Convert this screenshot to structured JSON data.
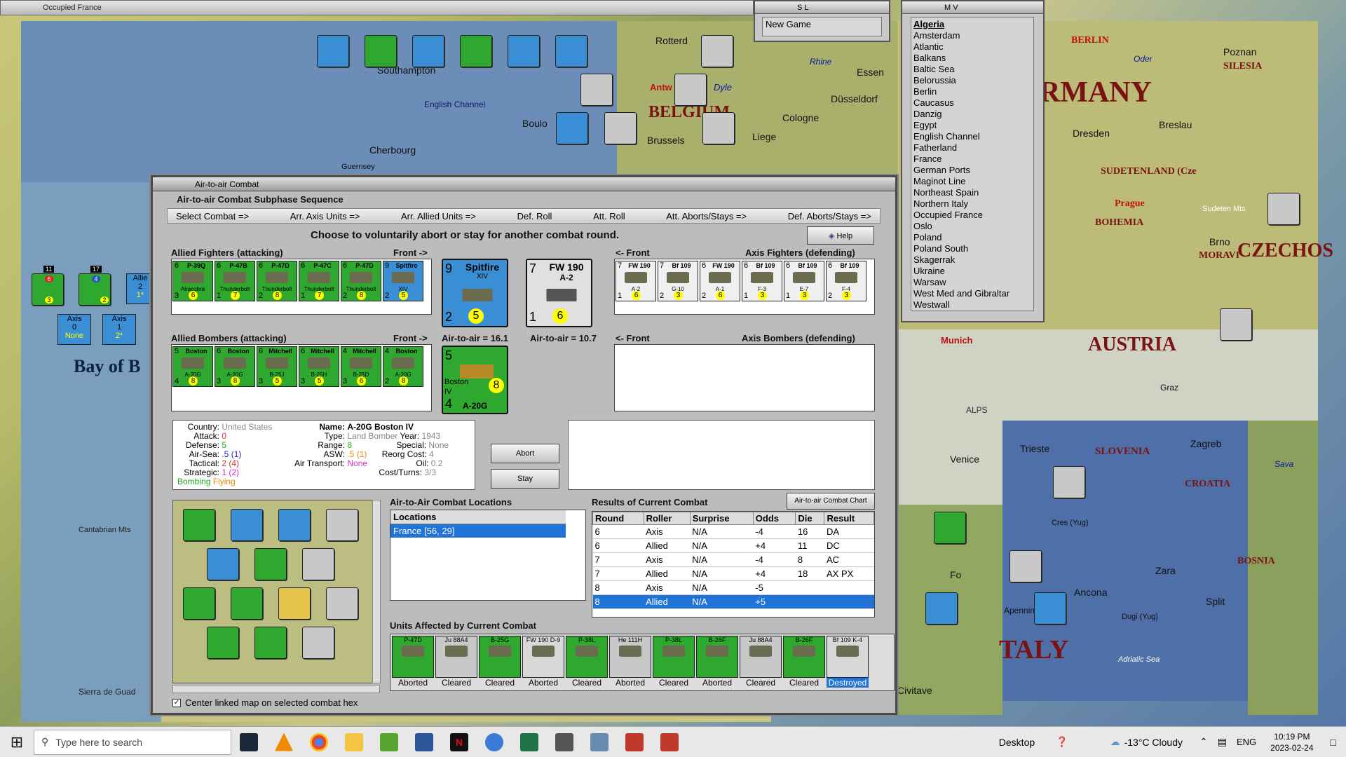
{
  "window": {
    "title": "Occupied France"
  },
  "map": {
    "labels": [
      "BELGIUM",
      "RMANY",
      "AUSTRIA",
      "TALY",
      "CZECHOS",
      "Bay of B",
      "English Channel",
      "SUDETENLAND (Cze",
      "BOHEMIA",
      "SLOVENIA",
      "CROATIA",
      "BOSNIA",
      "SILESIA",
      "MORAVI",
      "Adriatic Sea",
      "BERLIN",
      "Prague"
    ],
    "cities": [
      "Southampton",
      "Rotterd",
      "Antw",
      "Dyle",
      "Essen",
      "Düsseldorf",
      "Cologne",
      "Brussels",
      "Liege",
      "Boulo",
      "Cherbourg",
      "Guernsey",
      "Dresden",
      "Breslau",
      "Brno",
      "Poznan",
      "Oder",
      "Rhine",
      "Munich",
      "Graz",
      "Trieste",
      "Zagreb",
      "Venice",
      "Split",
      "Zara",
      "Ancona",
      "Apennine M",
      "Cres (Yug)",
      "Dugi (Yug)",
      "Sava",
      "ALPS",
      "Sudeten Mts",
      "Cantabrian Mts",
      "Sierra de Guad",
      "Civitave",
      "Fo"
    ]
  },
  "left_units": [
    {
      "top": "11",
      "mid": "6",
      "bot": "3"
    },
    {
      "top": "17",
      "mid": "4",
      "bot": "2"
    }
  ],
  "axis_boxes": [
    {
      "title": "Axis",
      "value": "0",
      "sub": "None"
    },
    {
      "title": "Axis",
      "value": "1",
      "sub": "2*"
    },
    {
      "title": "Allie",
      "value": "2",
      "sub": "1*"
    }
  ],
  "sl_panel": {
    "title": "S L",
    "item": "New Game"
  },
  "mv_panel": {
    "title": "M V",
    "items": [
      "Algeria",
      "Amsterdam",
      "Atlantic",
      "Balkans",
      "Baltic Sea",
      "Belorussia",
      "Berlin",
      "Caucasus",
      "Danzig",
      "Egypt",
      "English Channel",
      "Fatherland",
      "France",
      "German Ports",
      "Maginot Line",
      "Northeast Spain",
      "Northern Italy",
      "Occupied France",
      "Oslo",
      "Poland",
      "Poland South",
      "Skagerrak",
      "Ukraine",
      "Warsaw",
      "West Med and Gibraltar",
      "Westwall"
    ]
  },
  "dialog": {
    "title": "Air-to-air Combat",
    "subphase_title": "Air-to-air Combat Subphase Sequence",
    "sequence": [
      "Select Combat =>",
      "Arr. Axis Units =>",
      "Arr. Allied Units =>",
      "Def. Roll",
      "Att. Roll",
      "Att. Aborts/Stays =>",
      "Def. Aborts/Stays =>"
    ],
    "prompt": "Choose to voluntarily abort or stay for another combat round.",
    "help_label": "Help",
    "allied_fighters_label": "Allied Fighters (attacking)",
    "front_right": "Front ->",
    "front_left": "<- Front",
    "axis_fighters_label": "Axis Fighters (defending)",
    "allied_bombers_label": "Allied Bombers (attacking)",
    "axis_bombers_label": "Axis Bombers (defending)",
    "allied_fighters": [
      {
        "top": "6",
        "name": "P-39Q",
        "sub": "Airacobra",
        "a": "3",
        "b": "6"
      },
      {
        "top": "6",
        "name": "P-47B",
        "sub": "Thunderbolt",
        "a": "1",
        "b": "7"
      },
      {
        "top": "6",
        "name": "P-47D",
        "sub": "Thunderbolt",
        "a": "2",
        "b": "8"
      },
      {
        "top": "6",
        "name": "P-47C",
        "sub": "Thunderbolt",
        "a": "1",
        "b": "7"
      },
      {
        "top": "6",
        "name": "P-47D",
        "sub": "Thunderbolt",
        "a": "2",
        "b": "8"
      },
      {
        "top": "9",
        "name": "Spitfire",
        "sub": "XIV",
        "a": "2",
        "b": "5"
      }
    ],
    "axis_fighters": [
      {
        "top": "7",
        "name": "FW 190",
        "sub": "A-2",
        "a": "1",
        "b": "6"
      },
      {
        "top": "7",
        "name": "Bf 109",
        "sub": "G-10",
        "a": "2",
        "b": "3"
      },
      {
        "top": "6",
        "name": "FW 190",
        "sub": "A-1",
        "a": "2",
        "b": "6"
      },
      {
        "top": "6",
        "name": "Bf 109",
        "sub": "F-3",
        "a": "1",
        "b": "3"
      },
      {
        "top": "6",
        "name": "Bf 109",
        "sub": "E-7",
        "a": "1",
        "b": "3"
      },
      {
        "top": "6",
        "name": "Bf 109",
        "sub": "F-4",
        "a": "2",
        "b": "3"
      }
    ],
    "allied_bombers": [
      {
        "top": "5",
        "name": "Boston",
        "sub": "A-20G",
        "a": "4",
        "b": "8"
      },
      {
        "top": "6",
        "name": "Boston",
        "sub": "A-20G",
        "a": "3",
        "b": "8"
      },
      {
        "top": "6",
        "name": "Mitchell",
        "sub": "B-25J",
        "a": "3",
        "b": "5"
      },
      {
        "top": "6",
        "name": "Mitchell",
        "sub": "B-25H",
        "a": "3",
        "b": "5"
      },
      {
        "top": "4",
        "name": "Mitchell",
        "sub": "B-25D",
        "a": "3",
        "b": "6"
      },
      {
        "top": "4",
        "name": "Boston",
        "sub": "A-20G",
        "a": "2",
        "b": "8"
      }
    ],
    "big_allied_fighter": {
      "top": "9",
      "name": "Spitfire",
      "sub": "XIV",
      "a": "2",
      "b": "5"
    },
    "big_axis_fighter": {
      "top": "7",
      "name": "FW 190",
      "sub": "A-2",
      "a": "1",
      "b": "6"
    },
    "big_allied_bomber": {
      "top": "5",
      "name": "Boston",
      "sub": "IV",
      "a": "4",
      "b": "8",
      "label": "A-20G"
    },
    "air_to_air_left": "Air-to-air = 16.1",
    "air_to_air_right": "Air-to-air = 10.7",
    "info": {
      "country_label": "Country:",
      "country": "United States",
      "attack_label": "Attack:",
      "attack": "0",
      "defense_label": "Defense:",
      "defense": "5",
      "airsea_label": "Air-Sea:",
      "airsea": ".5",
      "airsea2": "(1)",
      "tactical_label": "Tactical:",
      "tactical": "2",
      "tactical2": "(4)",
      "strategic_label": "Strategic:",
      "strategic": "1",
      "strategic2": "(2)",
      "bombing": "Bombing",
      "flying": "Flying",
      "name_label": "Name:",
      "name": "A-20G Boston IV",
      "type_label": "Type:",
      "type": "Land Bomber",
      "year_label": "Year:",
      "year": "1943",
      "range_label": "Range:",
      "range": "8",
      "special_label": "Special:",
      "special": "None",
      "asw_label": "ASW:",
      "asw": ".5",
      "asw2": "(1)",
      "reorg_label": "Reorg Cost:",
      "reorg": "4",
      "transport_label": "Air Transport:",
      "transport": "None",
      "oil_label": "Oil:",
      "oil": "0.2",
      "cost_label": "Cost/Turns:",
      "cost": "3/3"
    },
    "abort_label": "Abort",
    "stay_label": "Stay",
    "locations_title": "Air-to-Air Combat Locations",
    "locations_header": "Locations",
    "locations": [
      "France [56, 29]"
    ],
    "results_title": "Results of Current Combat",
    "chart_button": "Air-to-air Combat Chart",
    "results_headers": [
      "Round",
      "Roller",
      "Surprise",
      "Odds",
      "Die",
      "Result"
    ],
    "results": [
      [
        "6",
        "Axis",
        "N/A",
        "-4",
        "16",
        "DA"
      ],
      [
        "6",
        "Allied",
        "N/A",
        "+4",
        "11",
        "DC"
      ],
      [
        "7",
        "Axis",
        "N/A",
        "-4",
        "8",
        "AC"
      ],
      [
        "7",
        "Allied",
        "N/A",
        "+4",
        "18",
        "AX PX"
      ],
      [
        "8",
        "Axis",
        "N/A",
        "-5",
        "",
        ""
      ],
      [
        "8",
        "Allied",
        "N/A",
        "+5",
        "",
        ""
      ]
    ],
    "affected_title": "Units Affected by Current Combat",
    "affected": [
      {
        "name": "P-47D",
        "status": "Aborted"
      },
      {
        "name": "Ju 88A4",
        "status": "Cleared"
      },
      {
        "name": "B-25G",
        "status": "Cleared"
      },
      {
        "name": "FW 190 D-9",
        "status": "Aborted"
      },
      {
        "name": "P-38L",
        "status": "Cleared"
      },
      {
        "name": "He 111H",
        "status": "Aborted"
      },
      {
        "name": "P-38L",
        "status": "Cleared"
      },
      {
        "name": "B-26F",
        "status": "Aborted"
      },
      {
        "name": "Ju 88A4",
        "status": "Cleared"
      },
      {
        "name": "B-26F",
        "status": "Cleared"
      },
      {
        "name": "Bf 109 K-4",
        "status": "Destroyed"
      }
    ],
    "center_checkbox": "Center linked map on selected combat hex"
  },
  "taskbar": {
    "search_placeholder": "Type here to search",
    "desktop": "Desktop",
    "weather": "-13°C  Cloudy",
    "lang": "ENG",
    "time": "10:19 PM",
    "date": "2023-02-24"
  },
  "colors": {
    "green": "#2fa82f",
    "blue": "#3a8fd4",
    "select": "#2173d8",
    "maptext": "#7a1212"
  }
}
